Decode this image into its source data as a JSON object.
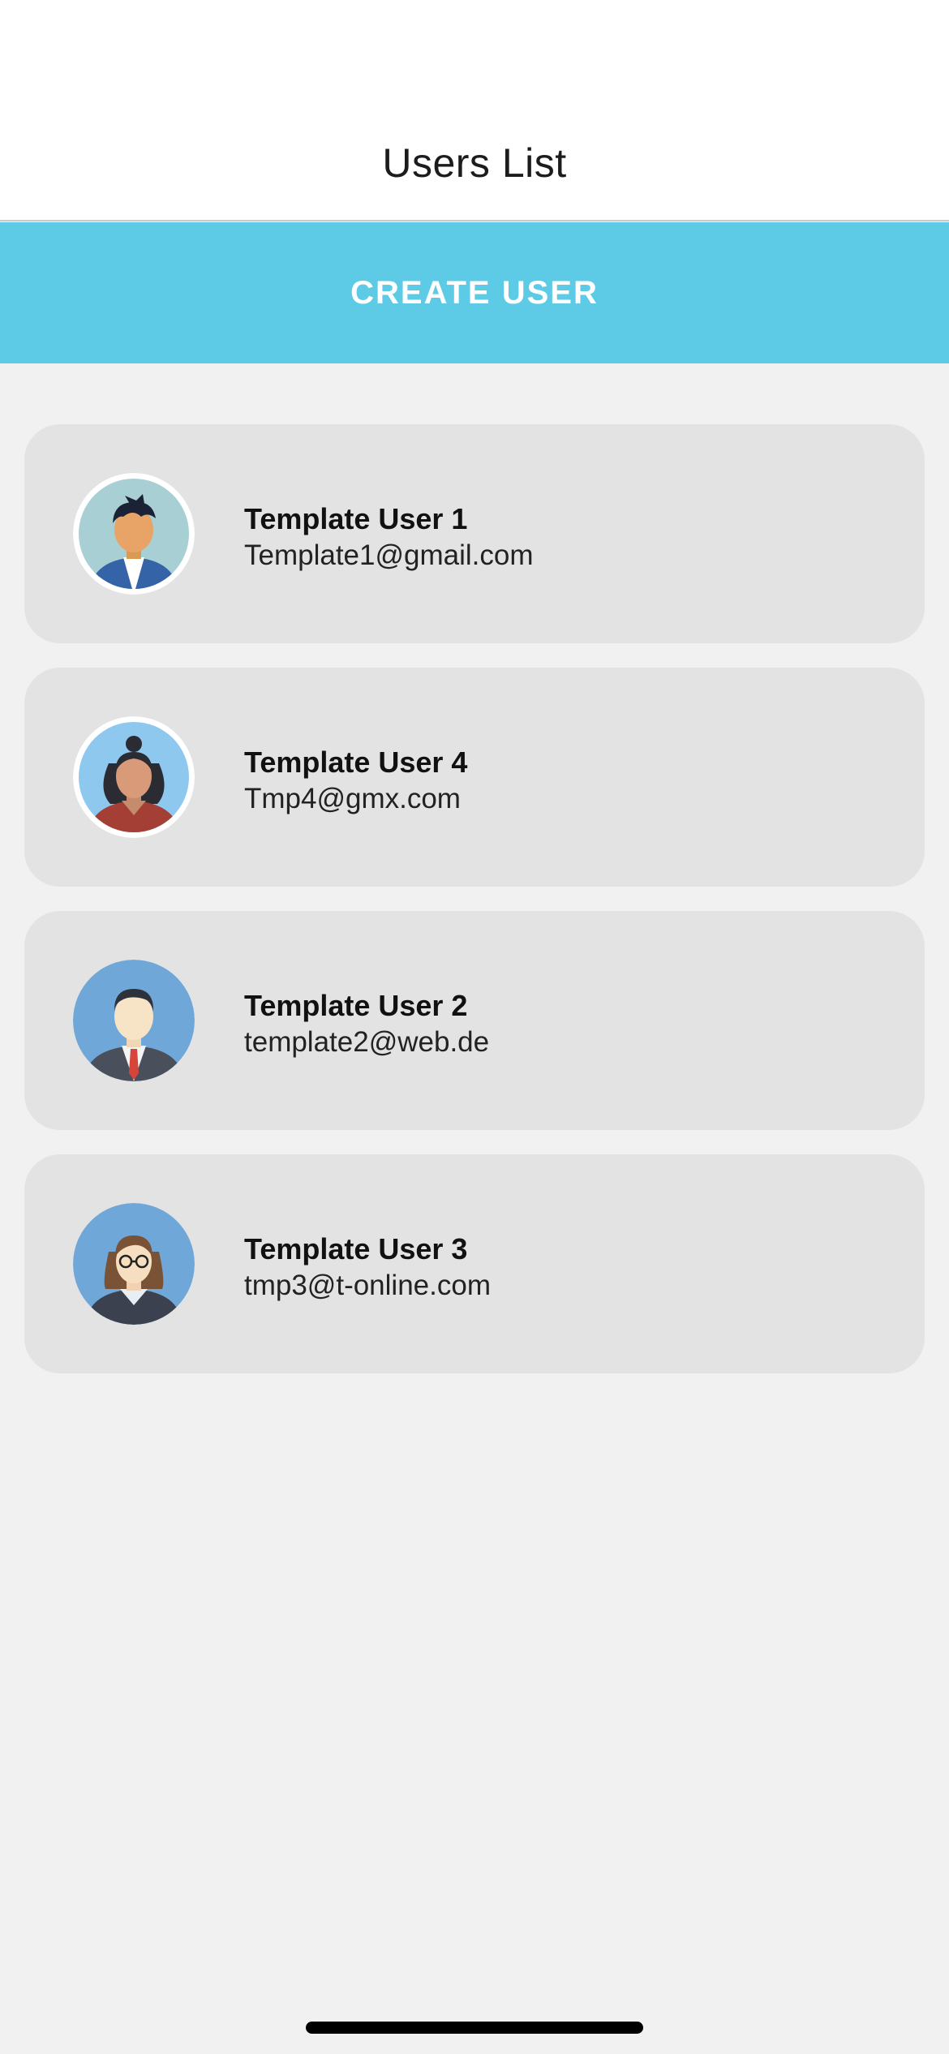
{
  "header": {
    "title": "Users List"
  },
  "actions": {
    "create_user_label": "CREATE USER"
  },
  "users": [
    {
      "name": "Template User 1",
      "email": "Template1@gmail.com",
      "avatar_icon": "avatar-man-blue-jacket-icon"
    },
    {
      "name": "Template User 4",
      "email": "Tmp4@gmx.com",
      "avatar_icon": "avatar-woman-bun-icon"
    },
    {
      "name": "Template User 2",
      "email": "template2@web.de",
      "avatar_icon": "avatar-man-suit-icon"
    },
    {
      "name": "Template User 3",
      "email": "tmp3@t-online.com",
      "avatar_icon": "avatar-woman-glasses-icon"
    }
  ],
  "colors": {
    "accent": "#5ecbe6",
    "card": "#e3e3e3",
    "background": "#f1f1f1",
    "header": "#ffffff"
  }
}
